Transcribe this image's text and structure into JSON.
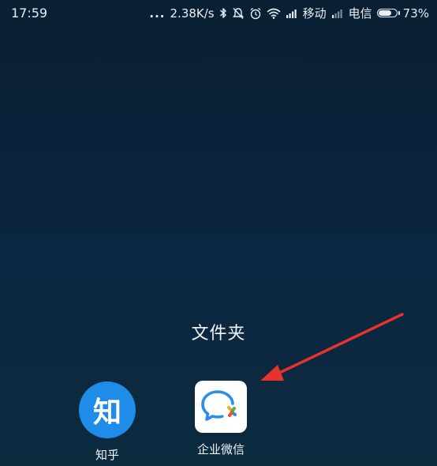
{
  "status_bar": {
    "time": "17:59",
    "dots": "...",
    "speed": "2.38K/s",
    "carrier1": "移动",
    "carrier2": "电信",
    "battery": "73%",
    "battery_level": 0.73,
    "icons": [
      "bluetooth-icon",
      "mute-icon",
      "alarm-icon",
      "wifi-icon",
      "signal-icon",
      "signal-weak-icon",
      "battery-icon"
    ]
  },
  "folder": {
    "title": "文件夹",
    "apps": [
      {
        "label": "知乎",
        "icon": "zhihu-icon",
        "glyph": "知",
        "color": "#1e8ce8"
      },
      {
        "label": "企业微信",
        "icon": "wecom-icon",
        "color": "#ffffff"
      }
    ]
  },
  "annotation": {
    "icon": "red-arrow-icon",
    "color": "#e8322c"
  },
  "colors": {
    "background": "#0b2238",
    "text": "#f0f4f8"
  }
}
